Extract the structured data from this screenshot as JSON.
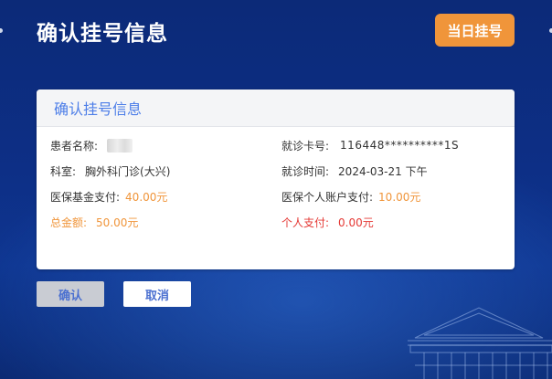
{
  "page": {
    "title": "确认挂号信息"
  },
  "header_button": {
    "label": "当日挂号"
  },
  "card": {
    "title": "确认挂号信息",
    "patient_name_label": "患者名称:",
    "patient_name_value": "",
    "card_no_label": "就诊卡号:",
    "card_no_value": "116448**********1S",
    "department_label": "科室:",
    "department_value": "胸外科门诊(大兴)",
    "visit_time_label": "就诊时间:",
    "visit_time_value": "2024-03-21 下午",
    "insurance_fund_label": "医保基金支付:",
    "insurance_fund_value": "40.00元",
    "insurance_personal_label": "医保个人账户支付:",
    "insurance_personal_value": "10.00元",
    "total_label": "总金额:",
    "total_value": "50.00元",
    "self_pay_label": "个人支付:",
    "self_pay_value": "0.00元"
  },
  "actions": {
    "confirm_label": "确认",
    "cancel_label": "取消"
  },
  "colors": {
    "background": "#0d2f86",
    "accent_orange": "#f0953a",
    "accent_blue": "#4d7ee8",
    "self_pay_red": "#e53935"
  },
  "icons": {
    "decoration": "building-illustration"
  }
}
